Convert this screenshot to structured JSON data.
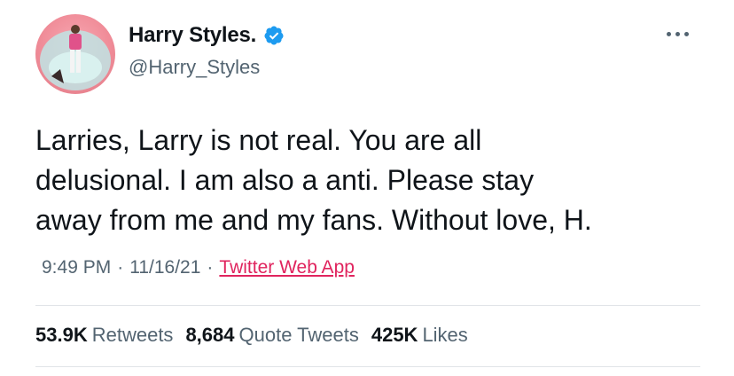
{
  "user": {
    "display_name": "Harry Styles.",
    "handle": "@Harry_Styles",
    "verified": true
  },
  "tweet": {
    "lines": [
      "Larries, Larry is not real. You are all",
      "delusional. I am also a anti. Please stay",
      "away from me and my fans. Without love, H."
    ]
  },
  "meta": {
    "time": "9:49 PM",
    "sep1": "·",
    "date": "11/16/21",
    "sep2": "·",
    "source": "Twitter Web App"
  },
  "stats": {
    "retweets_count": "53.9K",
    "retweets_label": "Retweets",
    "quote_count": "8,684",
    "quote_label": "Quote Tweets",
    "likes_count": "425K",
    "likes_label": "Likes"
  },
  "colors": {
    "verified_blue": "#1d9bf0",
    "source_link": "#e0245e",
    "secondary_text": "#536471"
  },
  "icons": {
    "verified": "verified-badge-icon",
    "more": "more-options-icon"
  }
}
